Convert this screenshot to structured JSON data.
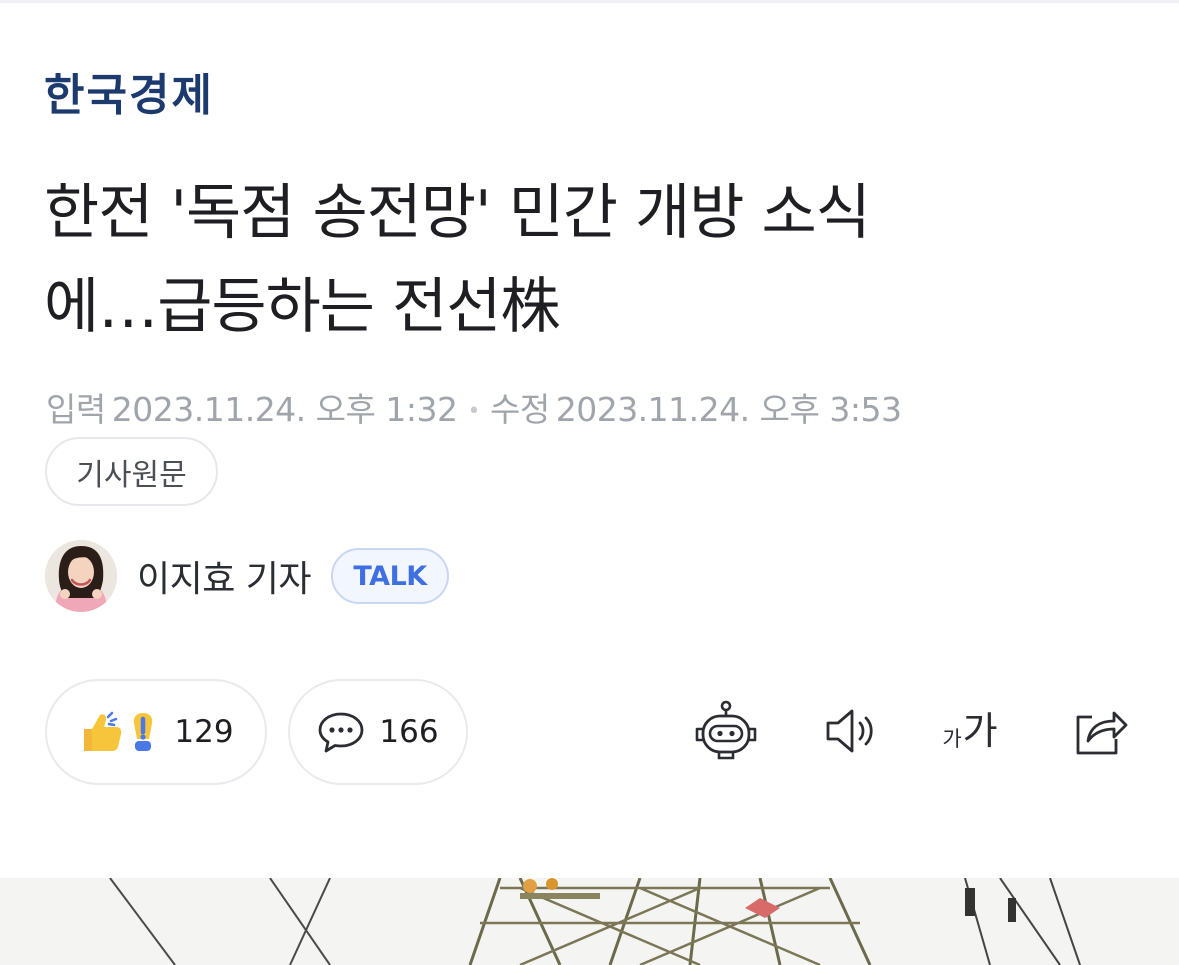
{
  "press": {
    "name": "한국경제"
  },
  "article": {
    "headline_line1": "한전 '독점 송전망' 민간 개방 소식",
    "headline_line2": "에…급등하는 전선株",
    "input_label": "입력",
    "input_date": "2023.11.24. 오후 1:32",
    "modified_label": "수정",
    "modified_date": "2023.11.24. 오후 3:53",
    "origin_button": "기사원문"
  },
  "reporter": {
    "name": "이지효 기자",
    "talk_label": "TALK"
  },
  "reactions": {
    "reaction_count": "129",
    "comment_count": "166"
  },
  "toolbar": {
    "font_small": "가",
    "font_large": "가"
  },
  "icons": [
    "thumbs-up-icon",
    "exclamation-icon",
    "speech-bubble-icon",
    "robot-summary-icon",
    "speaker-icon",
    "font-size-icon",
    "share-icon"
  ],
  "colors": {
    "press_logo": "#1c3a6d",
    "headline": "#1e1e23",
    "meta": "#a0a4ab",
    "talk_accent": "#3f6fe0",
    "reaction_yellow": "#f7c53c",
    "reaction_blue": "#4a78e6"
  }
}
